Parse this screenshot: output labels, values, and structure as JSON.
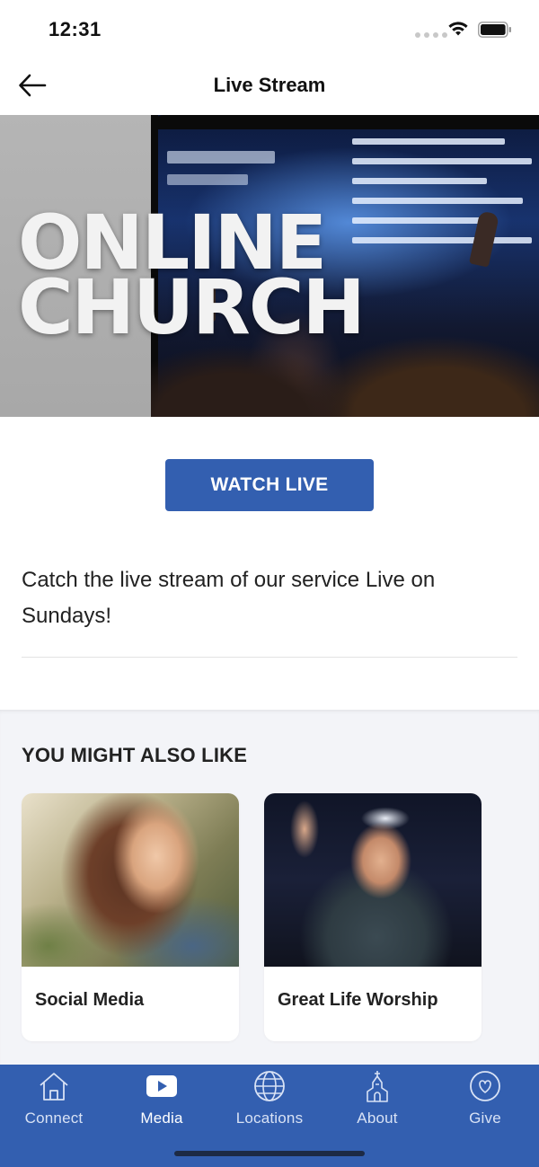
{
  "status_bar": {
    "time": "12:31"
  },
  "header": {
    "title": "Live Stream"
  },
  "hero": {
    "line1": "ONLINE",
    "line2": "CHURCH"
  },
  "watch_button": {
    "label": "WATCH LIVE"
  },
  "description": "Catch the live stream of our service Live on Sundays!",
  "related": {
    "heading": "YOU MIGHT ALSO LIKE",
    "cards": [
      {
        "title": "Social Media"
      },
      {
        "title": "Great Life Worship"
      }
    ]
  },
  "tab_bar": {
    "active": "Media",
    "items": [
      {
        "label": "Connect",
        "icon": "house-icon"
      },
      {
        "label": "Media",
        "icon": "play-icon"
      },
      {
        "label": "Locations",
        "icon": "globe-icon"
      },
      {
        "label": "About",
        "icon": "church-icon"
      },
      {
        "label": "Give",
        "icon": "heart-icon"
      }
    ]
  },
  "colors": {
    "accent": "#335fb0",
    "tab_bar": "#335fb0",
    "section_bg": "#f3f4f8"
  }
}
